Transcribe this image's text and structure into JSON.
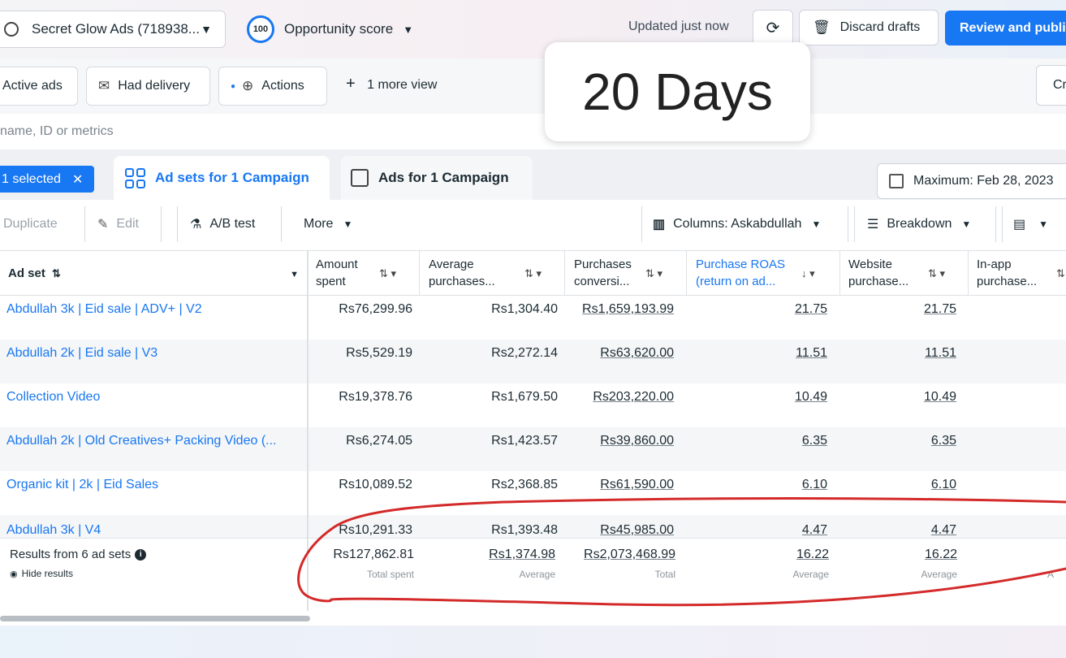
{
  "header": {
    "account_name": "Secret Glow Ads (718938...",
    "opportunity_score": "100",
    "opportunity_label": "Opportunity score",
    "updated_text": "Updated just now",
    "discard_label": "Discard drafts",
    "review_label": "Review and publi"
  },
  "filters": {
    "chips": [
      {
        "label": "Active ads",
        "icon": "none"
      },
      {
        "label": "Had delivery",
        "icon": "delivery-icon"
      },
      {
        "label": "Actions",
        "icon": "actions-icon"
      }
    ],
    "more_view": "1 more view",
    "right_chip": "Cr"
  },
  "search": {
    "placeholder": "name, ID or metrics"
  },
  "tabs": {
    "selected_pill": "1 selected",
    "ad_sets": "Ad sets for 1 Campaign",
    "ads": "Ads for 1 Campaign",
    "date_range": "Maximum: Feb 28, 2023"
  },
  "toolbar": {
    "duplicate": "Duplicate",
    "edit": "Edit",
    "ab_test": "A/B test",
    "more": "More",
    "columns": "Columns: Askabdullah",
    "breakdown": "Breakdown"
  },
  "table": {
    "headers": {
      "ad_set": "Ad set",
      "amount_spent_1": "Amount",
      "amount_spent_2": "spent",
      "avg_purchases_1": "Average",
      "avg_purchases_2": "purchases...",
      "purchases_conv_1": "Purchases",
      "purchases_conv_2": "conversi...",
      "roas_1": "Purchase ROAS",
      "roas_2": "(return on ad...",
      "website_1": "Website",
      "website_2": "purchase...",
      "inapp_1": "In-app",
      "inapp_2": "purchase..."
    },
    "rows": [
      {
        "name": "Abdullah 3k | Eid sale | ADV+ | V2",
        "spent": "Rs76,299.96",
        "avg": "Rs1,304.40",
        "conv": "Rs1,659,193.99",
        "roas": "21.75",
        "website": "21.75"
      },
      {
        "name": "Abdullah 2k | Eid sale | V3",
        "spent": "Rs5,529.19",
        "avg": "Rs2,272.14",
        "conv": "Rs63,620.00",
        "roas": "11.51",
        "website": "11.51"
      },
      {
        "name": "Collection Video",
        "spent": "Rs19,378.76",
        "avg": "Rs1,679.50",
        "conv": "Rs203,220.00",
        "roas": "10.49",
        "website": "10.49"
      },
      {
        "name": "Abdullah 2k | Old Creatives+ Packing Video (...",
        "spent": "Rs6,274.05",
        "avg": "Rs1,423.57",
        "conv": "Rs39,860.00",
        "roas": "6.35",
        "website": "6.35"
      },
      {
        "name": "Organic kit | 2k | Eid Sales",
        "spent": "Rs10,089.52",
        "avg": "Rs2,368.85",
        "conv": "Rs61,590.00",
        "roas": "6.10",
        "website": "6.10"
      },
      {
        "name": "Abdullah 3k | V4",
        "spent": "Rs10,291.33",
        "avg": "Rs1,393.48",
        "conv": "Rs45,985.00",
        "roas": "4.47",
        "website": "4.47"
      }
    ],
    "summary": {
      "label": "Results from 6 ad sets",
      "hide": "Hide results",
      "spent": "Rs127,862.81",
      "spent_label": "Total spent",
      "avg": "Rs1,374.98",
      "avg_label": "Average",
      "conv": "Rs2,073,468.99",
      "conv_label": "Total",
      "roas": "16.22",
      "roas_label": "Average",
      "website": "16.22",
      "website_label": "Average",
      "inapp_label": "A"
    }
  },
  "overlay": {
    "text": "20 Days"
  },
  "colors": {
    "accent": "#1877f2",
    "annotation": "#d42a2a"
  }
}
